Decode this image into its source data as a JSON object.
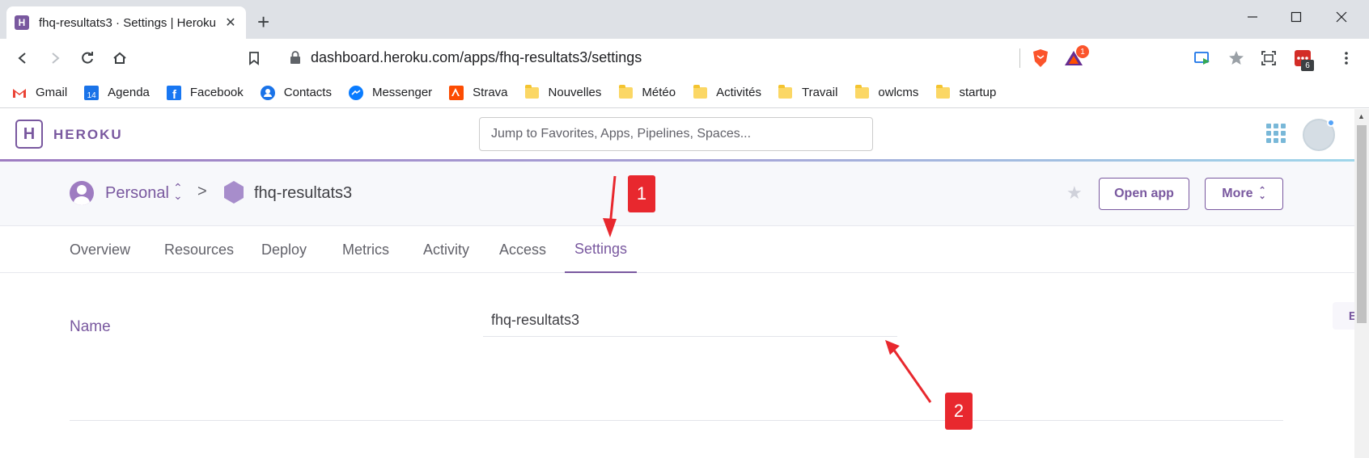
{
  "browser": {
    "tab_title": "fhq-resultats3 · Settings | Heroku",
    "url": "dashboard.heroku.com/apps/fhq-resultats3/settings",
    "brave_badge": "1",
    "extension_badge": "6",
    "bookmarks": [
      {
        "label": "Gmail",
        "icon": "gmail-icon"
      },
      {
        "label": "Agenda",
        "icon": "calendar-icon",
        "icon_text": "14"
      },
      {
        "label": "Facebook",
        "icon": "facebook-icon"
      },
      {
        "label": "Contacts",
        "icon": "contacts-icon"
      },
      {
        "label": "Messenger",
        "icon": "messenger-icon"
      },
      {
        "label": "Strava",
        "icon": "strava-icon"
      },
      {
        "label": "Nouvelles",
        "icon": "folder-icon"
      },
      {
        "label": "Météo",
        "icon": "folder-icon"
      },
      {
        "label": "Activités",
        "icon": "folder-icon"
      },
      {
        "label": "Travail",
        "icon": "folder-icon"
      },
      {
        "label": "owlcms",
        "icon": "folder-icon"
      },
      {
        "label": "startup",
        "icon": "folder-icon"
      }
    ]
  },
  "heroku": {
    "wordmark": "HEROKU",
    "logo_letter": "H",
    "search_placeholder": "Jump to Favorites, Apps, Pipelines, Spaces...",
    "breadcrumb": {
      "team": "Personal",
      "separator": ">",
      "app": "fhq-resultats3"
    },
    "buttons": {
      "open_app": "Open app",
      "more": "More"
    },
    "tabs": [
      "Overview",
      "Resources",
      "Deploy",
      "Metrics",
      "Activity",
      "Access",
      "Settings"
    ],
    "active_tab": "Settings",
    "settings": {
      "name_label": "Name",
      "name_value": "fhq-resultats3",
      "edit_label": "Edit"
    }
  },
  "annotations": {
    "callout_1": "1",
    "callout_2": "2",
    "color": "#e8282e"
  },
  "colors": {
    "heroku_purple": "#79589f",
    "chrome_tabbar": "#dee1e6"
  }
}
